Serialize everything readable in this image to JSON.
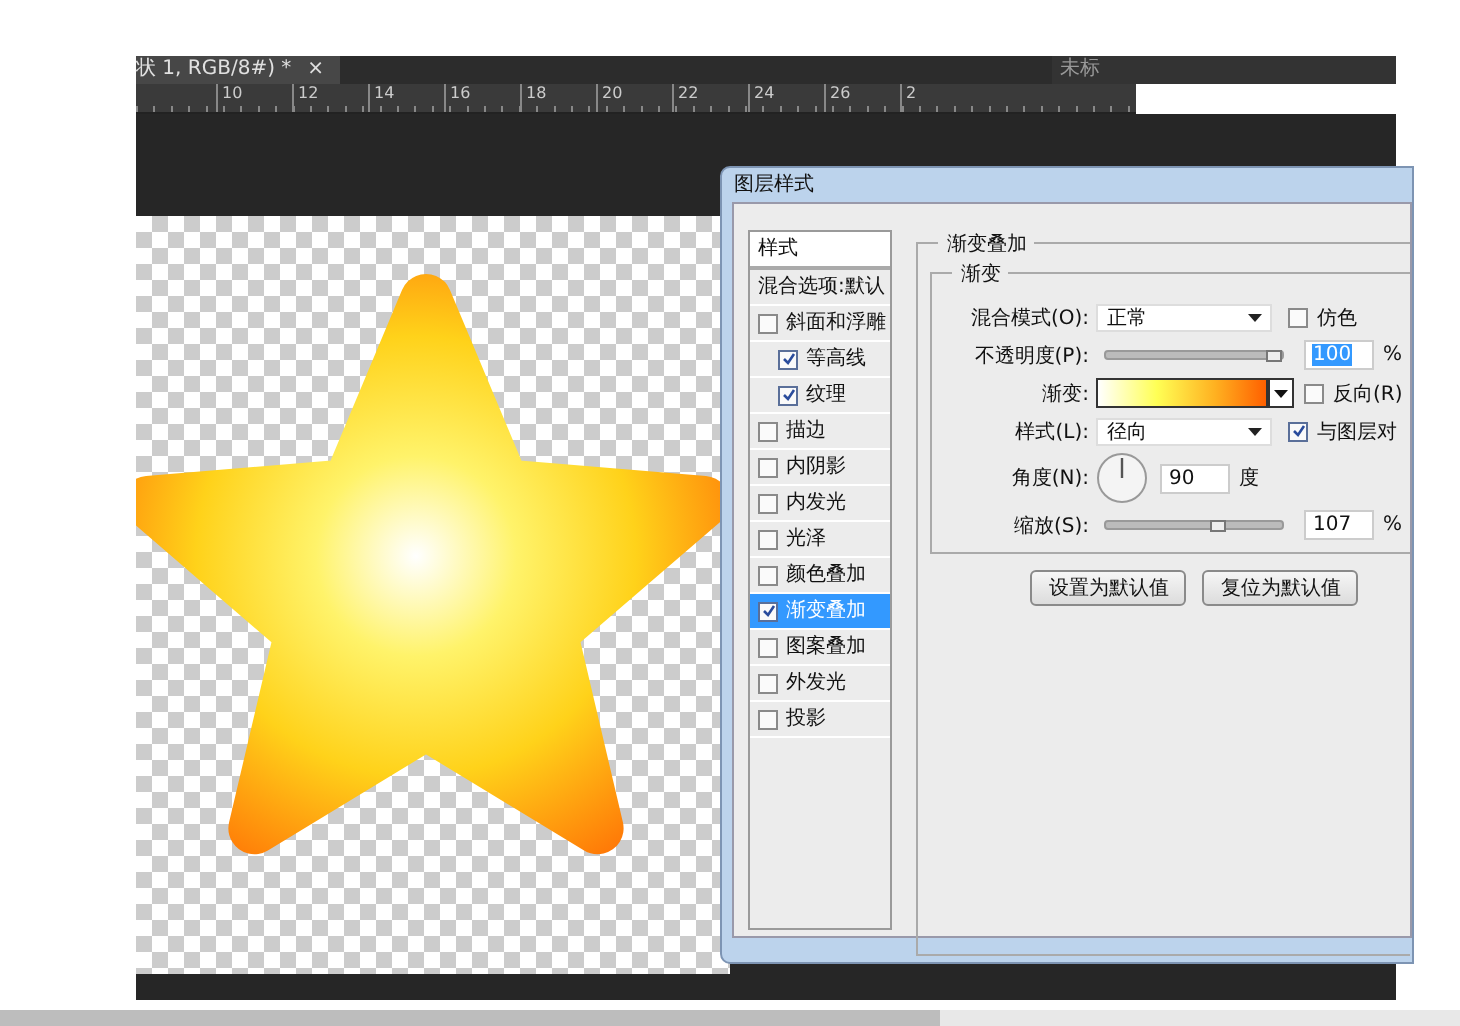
{
  "document_tabs": [
    {
      "label": "状 1, RGB/8#) *",
      "selected": true,
      "close": "×"
    },
    {
      "label": "未标",
      "selected": false
    }
  ],
  "ruler": [
    "10",
    "12",
    "14",
    "16",
    "18",
    "20",
    "22",
    "24",
    "26",
    "2"
  ],
  "dialog": {
    "title": "图层样式",
    "styles_header": "样式",
    "blend_options": "混合选项:默认",
    "effects": [
      {
        "label": "斜面和浮雕",
        "checked": false,
        "selected": false,
        "children": [
          {
            "label": "等高线",
            "checked": true,
            "selected": false
          },
          {
            "label": "纹理",
            "checked": true,
            "selected": false
          }
        ]
      },
      {
        "label": "描边",
        "checked": false,
        "selected": false
      },
      {
        "label": "内阴影",
        "checked": false,
        "selected": false
      },
      {
        "label": "内发光",
        "checked": false,
        "selected": false
      },
      {
        "label": "光泽",
        "checked": false,
        "selected": false
      },
      {
        "label": "颜色叠加",
        "checked": false,
        "selected": false
      },
      {
        "label": "渐变叠加",
        "checked": true,
        "selected": true
      },
      {
        "label": "图案叠加",
        "checked": false,
        "selected": false
      },
      {
        "label": "外发光",
        "checked": false,
        "selected": false
      },
      {
        "label": "投影",
        "checked": false,
        "selected": false
      }
    ],
    "section_title": "渐变叠加",
    "group_title": "渐变",
    "blend_mode": {
      "label": "混合模式(O):",
      "value": "正常",
      "dither": {
        "label": "仿色",
        "checked": false
      }
    },
    "opacity": {
      "label": "不透明度(P):",
      "level": 1.0,
      "value": "100",
      "unit": "%"
    },
    "gradient": {
      "label": "渐变:",
      "reverse": {
        "label": "反向(R)",
        "checked": false
      }
    },
    "style": {
      "label": "样式(L):",
      "value": "径向",
      "align": {
        "label": "与图层对",
        "checked": true
      }
    },
    "angle": {
      "label": "角度(N):",
      "value": "90",
      "unit": "度"
    },
    "scale": {
      "label": "缩放(S):",
      "level": 0.68,
      "value": "107",
      "unit": "%"
    },
    "buttons": [
      "设置为默认值",
      "复位为默认值"
    ]
  }
}
